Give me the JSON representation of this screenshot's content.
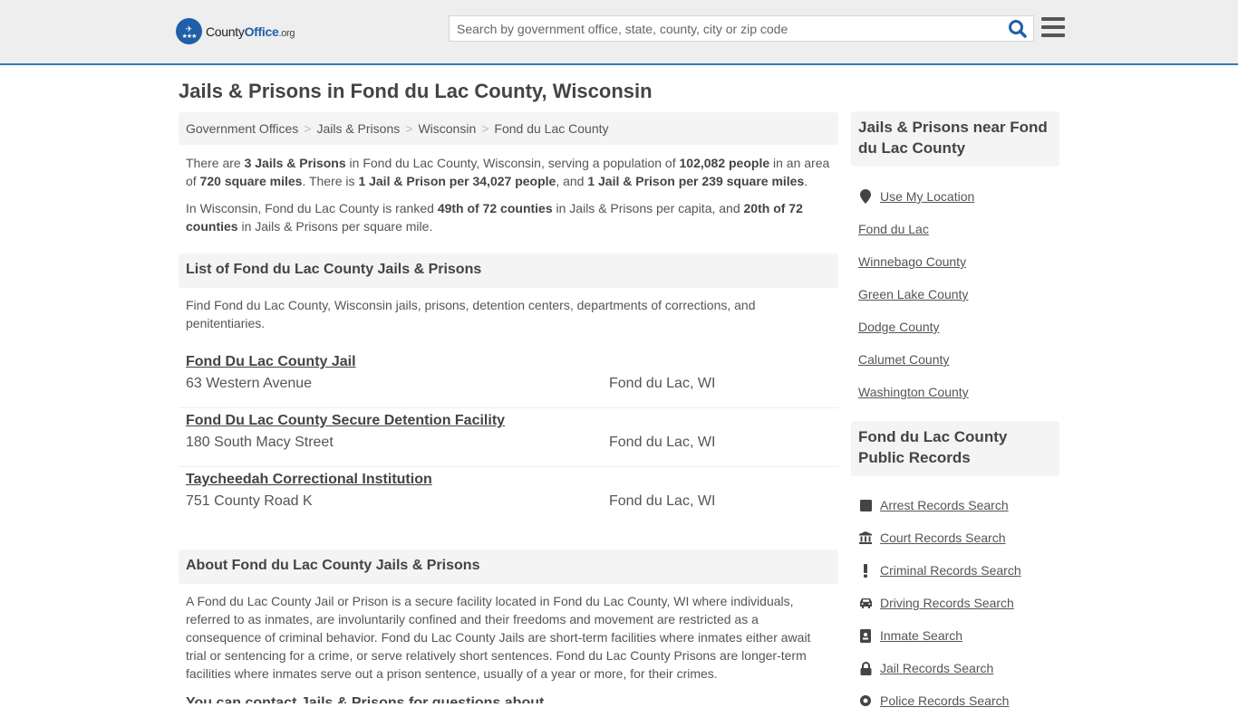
{
  "header": {
    "logo": {
      "county": "County",
      "office": "Office",
      "org": ".org"
    },
    "search_placeholder": "Search by government office, state, county, city or zip code",
    "search_value": "",
    "accent_color": "#337ab7"
  },
  "page_title": "Jails & Prisons in Fond du Lac County, Wisconsin",
  "breadcrumb": [
    "Government Offices",
    "Jails & Prisons",
    "Wisconsin",
    "Fond du Lac County"
  ],
  "intro": {
    "p1": {
      "t1": "There are ",
      "b1": "3 Jails & Prisons",
      "t2": " in Fond du Lac County, Wisconsin, serving a population of ",
      "b2": "102,082 people",
      "t3": " in an area of ",
      "b3": "720 square miles",
      "t4": ". There is ",
      "b4": "1 Jail & Prison per 34,027 people",
      "t5": ", and ",
      "b5": "1 Jail & Prison per 239 square miles",
      "t6": "."
    },
    "p2": {
      "t1": "In Wisconsin, Fond du Lac County is ranked ",
      "b1": "49th of 72 counties",
      "t2": " in Jails & Prisons per capita, and ",
      "b2": "20th of 72 counties",
      "t3": " in Jails & Prisons per square mile."
    }
  },
  "list_section": {
    "heading": "List of Fond du Lac County Jails & Prisons",
    "intro": "Find Fond du Lac County, Wisconsin jails, prisons, detention centers, departments of corrections, and penitentiaries.",
    "facilities": [
      {
        "name": "Fond Du Lac County Jail",
        "address": "63 Western Avenue",
        "city": "Fond du Lac, WI"
      },
      {
        "name": "Fond Du Lac County Secure Detention Facility",
        "address": "180 South Macy Street",
        "city": "Fond du Lac, WI"
      },
      {
        "name": "Taycheedah Correctional Institution",
        "address": "751 County Road K",
        "city": "Fond du Lac, WI"
      }
    ]
  },
  "about_section": {
    "heading": "About Fond du Lac County Jails & Prisons",
    "text": "A Fond du Lac County Jail or Prison is a secure facility located in Fond du Lac County, WI where individuals, referred to as inmates, are involuntarily confined and their freedoms and movement are restricted as a consequence of criminal behavior. Fond du Lac County Jails are short-term facilities where inmates either await trial or sentencing for a crime, or serve relatively short sentences. Fond du Lac County Prisons are longer-term facilities where inmates serve out a prison sentence, usually of a year or more, for their crimes.",
    "next_heading_partial": "You can contact Jails & Prisons for questions about"
  },
  "sidebar": {
    "nearby": {
      "heading": "Jails & Prisons near Fond du Lac County",
      "use_location": "Use My Location",
      "links": [
        "Fond du Lac",
        "Winnebago County",
        "Green Lake County",
        "Dodge County",
        "Calumet County",
        "Washington County"
      ]
    },
    "records": {
      "heading": "Fond du Lac County Public Records",
      "links": [
        {
          "label": "Arrest Records Search",
          "icon": "square-icon"
        },
        {
          "label": "Court Records Search",
          "icon": "courthouse-icon"
        },
        {
          "label": "Criminal Records Search",
          "icon": "exclamation-icon"
        },
        {
          "label": "Driving Records Search",
          "icon": "car-icon"
        },
        {
          "label": "Inmate Search",
          "icon": "id-badge-icon"
        },
        {
          "label": "Jail Records Search",
          "icon": "lock-icon"
        },
        {
          "label": "Police Records Search",
          "icon": "police-badge-icon"
        }
      ]
    }
  }
}
